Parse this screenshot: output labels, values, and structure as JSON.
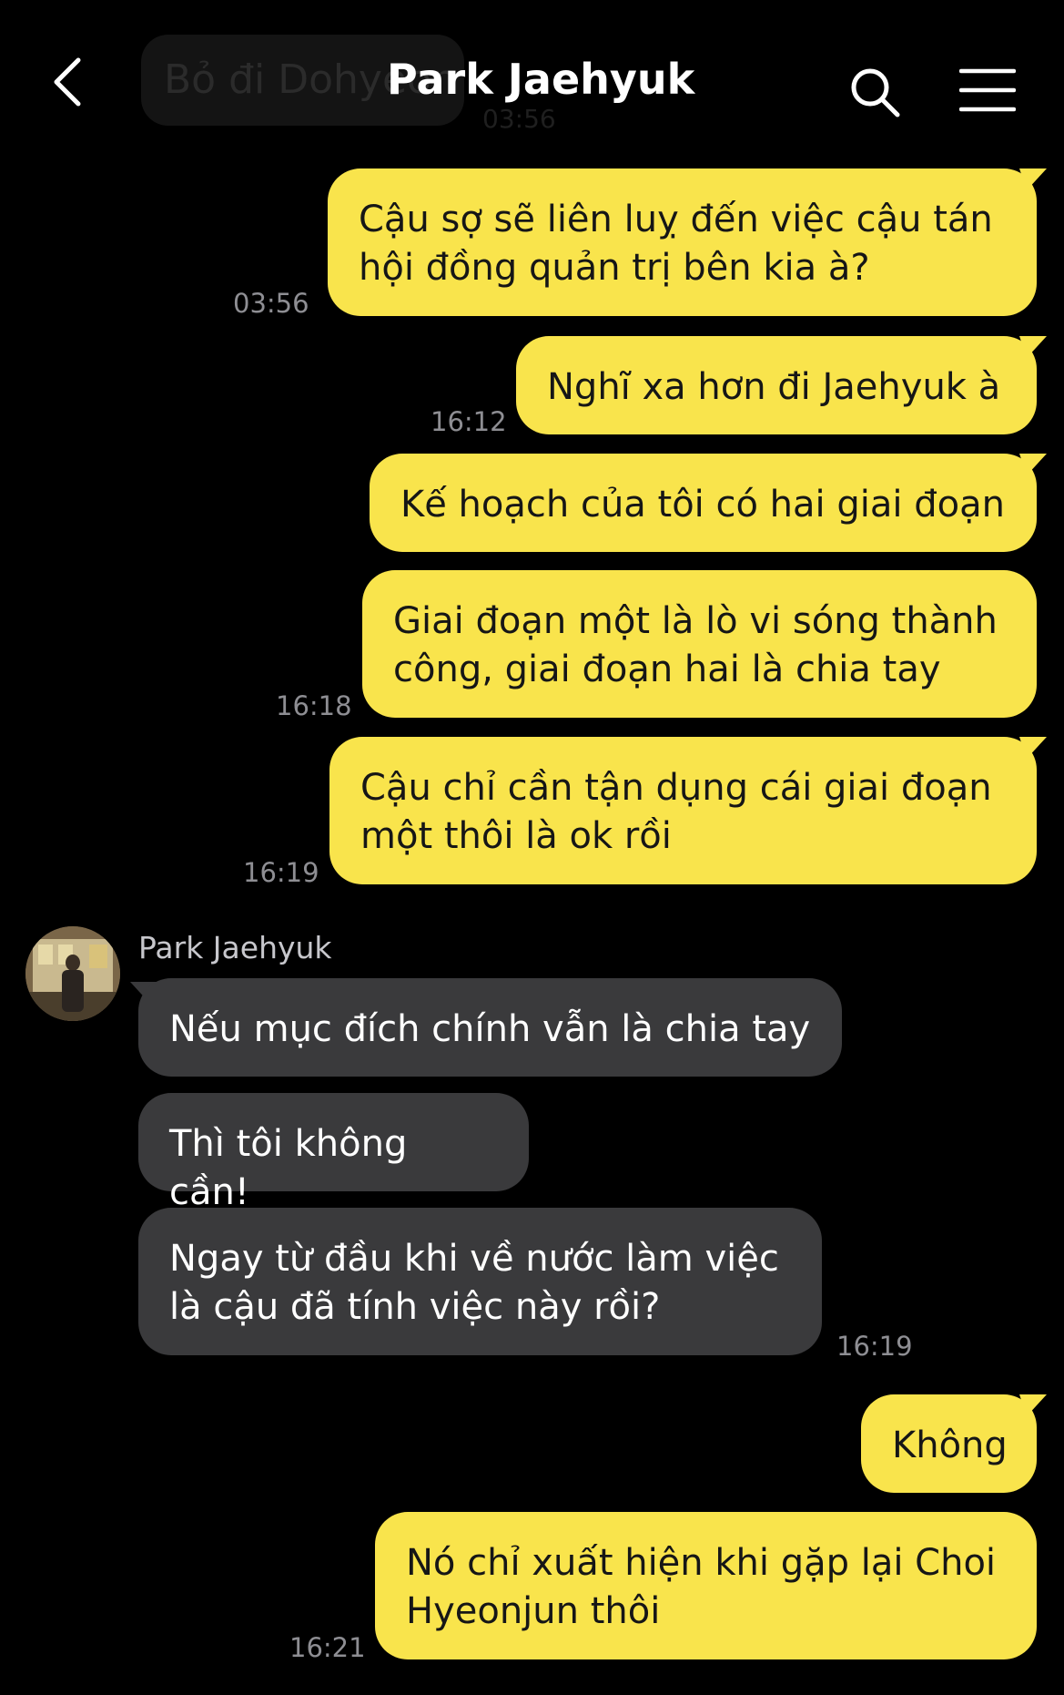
{
  "header": {
    "title": "Park Jaehyuk",
    "ghost_message": "Bỏ đi Dohyeon",
    "ghost_time": "03:56"
  },
  "sender_name": "Park Jaehyuk",
  "messages": [
    {
      "text": "Cậu sợ sẽ liên luỵ đến việc cậu tán hội đồng quản trị bên kia à?",
      "time": "03:56"
    },
    {
      "text": "Nghĩ xa hơn đi Jaehyuk à",
      "time": "16:12"
    },
    {
      "text": "Kế hoạch của tôi có hai giai đoạn",
      "time": ""
    },
    {
      "text": "Giai đoạn một là lò vi sóng thành công, giai đoạn hai là chia tay",
      "time": "16:18"
    },
    {
      "text": "Cậu chỉ cần tận dụng cái giai đoạn một thôi là ok rồi",
      "time": "16:19"
    },
    {
      "text": "Nếu mục đích chính vẫn là chia tay",
      "time": ""
    },
    {
      "text": "Thì tôi không cần!",
      "time": ""
    },
    {
      "text": "Ngay từ đầu khi về nước làm việc là cậu đã tính việc này rồi?",
      "time": "16:19"
    },
    {
      "text": "Không",
      "time": ""
    },
    {
      "text": "Nó chỉ xuất hiện khi gặp lại Choi Hyeonjun thôi",
      "time": "16:21"
    }
  ],
  "colors": {
    "background": "#000000",
    "my_bubble": "#F9E44C",
    "their_bubble": "#3A3A3C",
    "timestamp": "#8E8E93"
  },
  "icons": [
    "back-arrow-icon",
    "search-icon",
    "menu-icon"
  ]
}
